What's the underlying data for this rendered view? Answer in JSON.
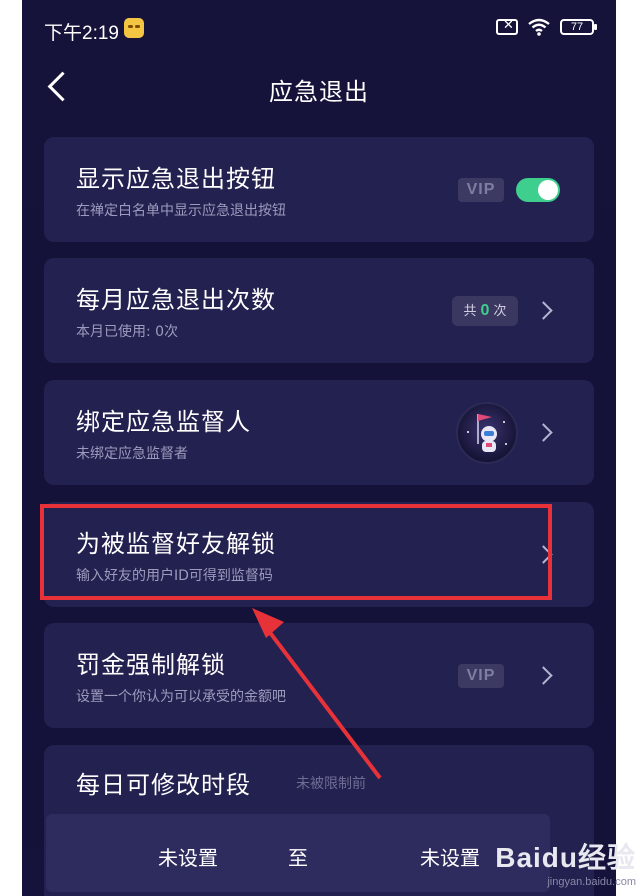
{
  "status_bar": {
    "time": "下午2:19",
    "battery": "77"
  },
  "nav": {
    "title": "应急退出"
  },
  "settings": [
    {
      "title": "显示应急退出按钮",
      "subtitle": "在禅定白名单中显示应急退出按钮",
      "badge": "VIP",
      "toggle_on": true
    },
    {
      "title": "每月应急退出次数",
      "subtitle": "本月已使用: 0次",
      "count_prefix": "共",
      "count_value": "0",
      "count_suffix": "次"
    },
    {
      "title": "绑定应急监督人",
      "subtitle": "未绑定应急监督者"
    },
    {
      "title": "为被监督好友解锁",
      "subtitle": "输入好友的用户ID可得到监督码"
    },
    {
      "title": "罚金强制解锁",
      "subtitle": "设置一个你认为可以承受的金额吧",
      "badge": "VIP"
    }
  ],
  "time_section": {
    "title": "每日可修改时段",
    "hint": "未被限制前",
    "start": "未设置",
    "separator": "至",
    "end": "未设置"
  },
  "watermark": {
    "brand": "Baidu经验",
    "url": "jingyan.baidu.com"
  },
  "colors": {
    "accent_green": "#3ecf8e",
    "highlight_red": "#e8323a",
    "card_bg": "#232150"
  }
}
